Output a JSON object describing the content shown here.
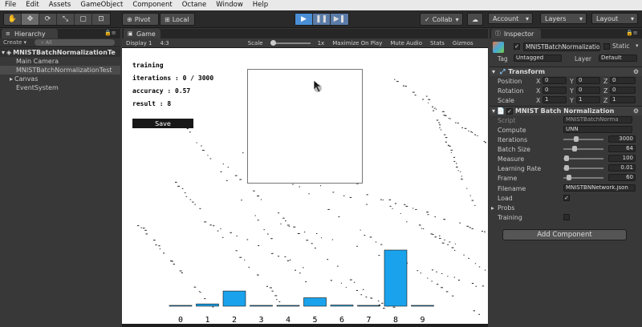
{
  "menubar": [
    "File",
    "Edit",
    "Assets",
    "GameObject",
    "Component",
    "Octane",
    "Window",
    "Help"
  ],
  "toolbar": {
    "pivot": "Pivot",
    "local": "Local",
    "collab": "Collab",
    "account": "Account",
    "layers": "Layers",
    "layout": "Layout"
  },
  "hierarchy": {
    "tab": "Hierarchy",
    "create": "Create",
    "search_placeholder": "All",
    "scene": "MNISTBatchNormalizationTe",
    "items": [
      "Main Camera",
      "MNISTBatchNormalizationTest",
      "Canvas",
      "EventSystem"
    ]
  },
  "game": {
    "tab": "Game",
    "display": "Display 1",
    "aspect": "4:3",
    "scale_label": "Scale",
    "scale_value": "1x",
    "maximize": "Maximize On Play",
    "mute": "Mute Audio",
    "stats": "Stats",
    "gizmos": "Gizmos"
  },
  "app": {
    "status": "training",
    "iterations": "iterations : 0 / 3000",
    "accuracy": "accuracy : 0.57",
    "result": "result : 8",
    "save_label": "Save"
  },
  "chart_data": {
    "type": "bar",
    "categories": [
      "0",
      "1",
      "2",
      "3",
      "4",
      "5",
      "6",
      "7",
      "8",
      "9"
    ],
    "values": [
      0.01,
      0.04,
      0.27,
      0.0,
      0.0,
      0.15,
      0.02,
      0.01,
      1.0,
      0.0
    ],
    "title": "",
    "xlabel": "",
    "ylabel": "",
    "ylim": [
      0,
      1
    ],
    "bar_color": "#1aa3ec"
  },
  "inspector": {
    "tab": "Inspector",
    "object_name": "MNISTBatchNormalizatio",
    "static": "Static",
    "tag_label": "Tag",
    "tag_value": "Untagged",
    "layer_label": "Layer",
    "layer_value": "Default",
    "transform": {
      "title": "Transform",
      "rows": [
        {
          "label": "Position",
          "x": "0",
          "y": "0",
          "z": "0"
        },
        {
          "label": "Rotation",
          "x": "0",
          "y": "0",
          "z": "0"
        },
        {
          "label": "Scale",
          "x": "1",
          "y": "1",
          "z": "1"
        }
      ]
    },
    "component": {
      "title": "MNIST Batch Normalization",
      "script_label": "Script",
      "script_value": "MNISTBatchNorma",
      "compute_label": "Compute",
      "compute_value": "UNN",
      "fields": [
        {
          "label": "Iterations",
          "value": "3000",
          "level": 0.3
        },
        {
          "label": "Batch Size",
          "value": "64",
          "level": 0.25
        },
        {
          "label": "Measure",
          "value": "100",
          "level": 0.02
        },
        {
          "label": "Learning Rate",
          "value": "0.01",
          "level": 0.02
        },
        {
          "label": "Frame",
          "value": "60",
          "level": 0.1
        }
      ],
      "filename_label": "Filename",
      "filename_value": "MNISTBNNetwork.json",
      "load_label": "Load",
      "load_checked": true,
      "probs_label": "Probs",
      "training_label": "Training",
      "training_checked": false
    },
    "add_component": "Add Component"
  }
}
